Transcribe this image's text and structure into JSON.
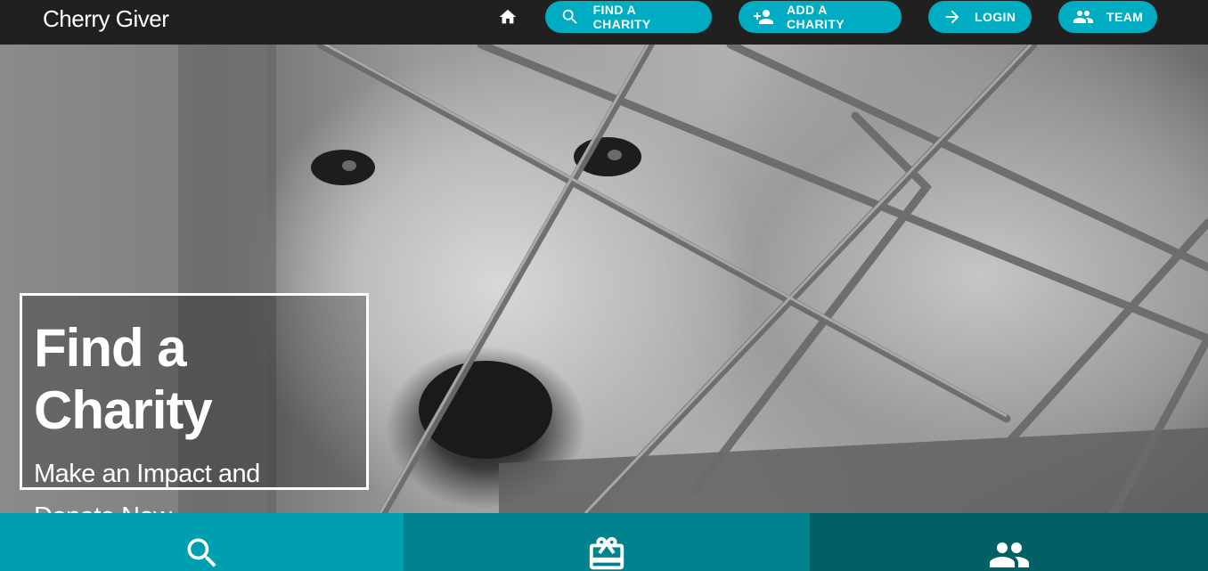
{
  "brand": {
    "name": "Cherry Giver"
  },
  "nav": {
    "home_icon": "home-icon",
    "buttons": [
      {
        "label": "FIND A CHARITY",
        "icon": "search-icon"
      },
      {
        "label": "ADD A CHARITY",
        "icon": "person-add-icon"
      },
      {
        "label": "LOGIN",
        "icon": "arrow-right-icon"
      },
      {
        "label": "TEAM",
        "icon": "people-icon"
      }
    ]
  },
  "hero": {
    "title": "Find a Charity",
    "subtitle_line1": "Make an Impact and",
    "subtitle_line2": "Donate Now"
  },
  "features": [
    {
      "icon": "search-icon",
      "color": "#009faf"
    },
    {
      "icon": "gift-card-icon",
      "color": "#00838f"
    },
    {
      "icon": "people-icon",
      "color": "#006064"
    }
  ],
  "colors": {
    "accent": "#00acc1",
    "navbar": "#202020"
  }
}
